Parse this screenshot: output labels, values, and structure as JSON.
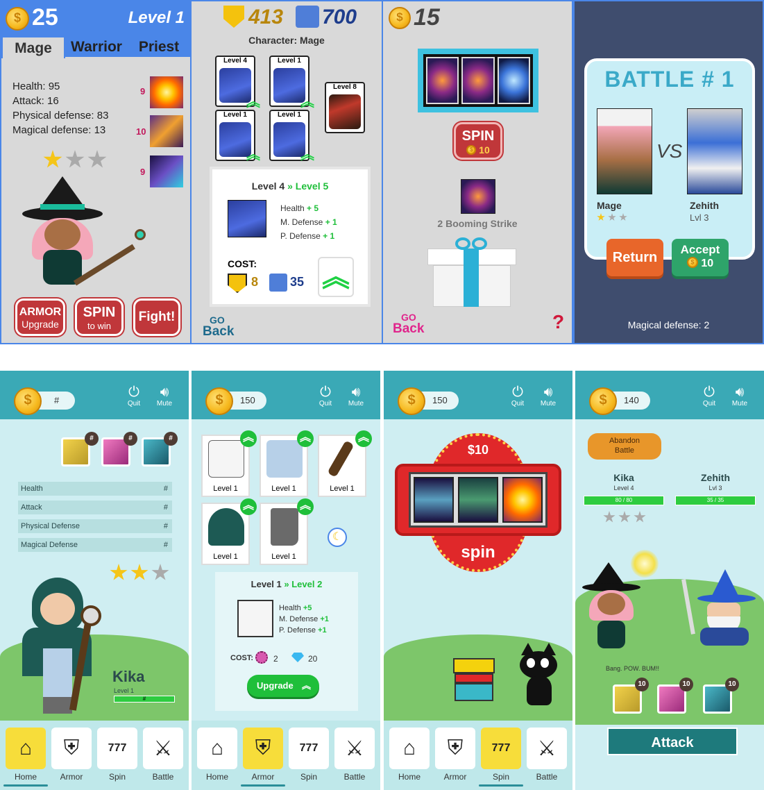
{
  "colors": {
    "border_blue": "#4a86e8",
    "gray_bg": "#d9d9d9",
    "red_button": "#c0373a",
    "green_highlight": "#1fd144",
    "teal_header": "#3aa9b6",
    "navy_bg": "#3f4d6e",
    "return_orange": "#e8662a",
    "accept_green": "#2ea46a"
  },
  "s1": {
    "coins": "25",
    "level": "Level 1",
    "tabs": [
      "Mage",
      "Warrior",
      "Priest"
    ],
    "stats": [
      "Health: 95",
      "Attack: 16",
      "Physical defense: 83",
      "Magical defense: 13"
    ],
    "skill_nums": [
      "9",
      "10",
      "9"
    ],
    "stars_filled": 1,
    "stars_total": 3,
    "btn_armor_1": "ARMOR",
    "btn_armor_2": "Upgrade",
    "btn_spin_1": "SPIN",
    "btn_spin_2": "to win",
    "btn_fight": "Fight!"
  },
  "s2": {
    "shields": "413",
    "puzzles": "700",
    "character": "Character: Mage",
    "cards": [
      "Level 4",
      "Level 1",
      "Level 1",
      "Level 1",
      "Level 8"
    ],
    "up_from": "Level 4",
    "up_arrows": "»",
    "up_to": "Level 5",
    "bonus_labels": [
      "Health",
      "M. Defense",
      "P. Defense"
    ],
    "bonus_vals": [
      "+ 5",
      "+ 1",
      "+ 1"
    ],
    "cost_label": "COST:",
    "cost_shield": "8",
    "cost_puzzle": "35",
    "go": "GO",
    "back": "Back"
  },
  "s3": {
    "coins": "15",
    "spin": "SPIN",
    "spin_cost": "10",
    "result": "2 Booming Strike",
    "go": "GO",
    "back": "Back",
    "help": "?"
  },
  "s4": {
    "title": "BATTLE # 1",
    "vs": "VS",
    "p1_name": "Mage",
    "p2_name": "Zehith",
    "p2_level": "Lvl 3",
    "return": "Return",
    "accept": "Accept",
    "accept_cost": "10",
    "footer": "Magical defense: 2"
  },
  "s5": {
    "coins": "#",
    "quit": "Quit",
    "mute": "Mute",
    "skill_badges": [
      "#",
      "#",
      "#"
    ],
    "stats": [
      {
        "label": "Health",
        "value": "#"
      },
      {
        "label": "Attack",
        "value": "#"
      },
      {
        "label": "Physical Defense",
        "value": "#"
      },
      {
        "label": "Magical Defense",
        "value": "#"
      }
    ],
    "stars_filled": 2,
    "stars_total": 3,
    "name": "Kika",
    "level": "Level 1",
    "xp_value": "#"
  },
  "s6": {
    "coins": "150",
    "quit": "Quit",
    "mute": "Mute",
    "cards": [
      "Level 1",
      "Level 1",
      "Level 1",
      "Level 1",
      "Level 1"
    ],
    "up_from": "Level 1",
    "up_arrows": "»",
    "up_to": "Level 2",
    "bonus_labels": [
      "Health",
      "M. Defense",
      "P. Defense"
    ],
    "bonus_vals": [
      "+5",
      "+1",
      "+1"
    ],
    "cost_label": "COST:",
    "cost_a": "2",
    "cost_b": "20",
    "upgrade": "Upgrade"
  },
  "s7": {
    "coins": "150",
    "quit": "Quit",
    "mute": "Mute",
    "price": "$10",
    "spin": "spin"
  },
  "s8": {
    "coins": "140",
    "quit": "Quit",
    "mute": "Mute",
    "abandon_1": "Abandon",
    "abandon_2": "Battle",
    "p1_name": "Kika",
    "p1_level": "Level 4",
    "p1_hp": "80 / 80",
    "p2_name": "Zehith",
    "p2_level": "Lvl 3",
    "p2_hp": "35 / 35",
    "log": "Bang. POW. BUM!!",
    "skill_badges": [
      "10",
      "10",
      "10"
    ],
    "attack": "Attack"
  },
  "nav": [
    "Home",
    "Armor",
    "Spin",
    "Battle"
  ]
}
